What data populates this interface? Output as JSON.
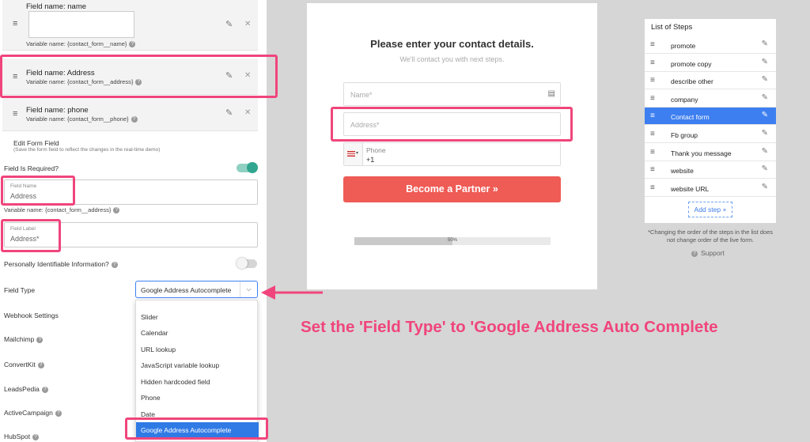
{
  "fields": {
    "name": {
      "title": "Field name: name",
      "var": "Variable name: {contact_form__name}"
    },
    "address": {
      "title": "Field name: Address",
      "var": "Variable name: {contact_form__address}"
    },
    "phone": {
      "title": "Field name: phone",
      "var": "Variable name: {contact_form__phone}"
    }
  },
  "edit": {
    "title": "Edit Form Field",
    "subtitle": "(Save the form field to reflect the changes in the real-time demo)",
    "required_label": "Field Is Required?",
    "required_on": true,
    "field_name_label": "Field Name",
    "field_name_value": "Address",
    "field_name_var": "Variable name: {contact_form__address}",
    "field_label_label": "Field Label",
    "field_label_value": "Address*",
    "pii_label": "Personally Identifiable Information?",
    "pii_on": false,
    "field_type_label": "Field Type",
    "field_type_value": "Google Address Autocomplete",
    "webhook": "Webhook Settings",
    "mailchimp": "Mailchimp",
    "convertkit": "ConvertKit",
    "leadspedia": "LeadsPedia",
    "activecampaign": "ActiveCampaign",
    "hubspot": "HubSpot"
  },
  "dropdown": {
    "options": [
      "Slider",
      "Calendar",
      "URL lookup",
      "JavaScript variable lookup",
      "Hidden hardcoded field",
      "Phone",
      "Date"
    ],
    "selected": "Google Address Autocomplete"
  },
  "form": {
    "heading": "Please enter your contact details.",
    "subheading": "We'll contact you with next steps.",
    "name_placeholder": "Name*",
    "address_placeholder": "Address*",
    "phone_label": "Phone",
    "phone_value": "+1",
    "submit": "Become a Partner »",
    "progress_text": "50%",
    "progress": 0.5
  },
  "steps": {
    "title": "List of Steps",
    "items": [
      "promote",
      "promote copy",
      "describe other",
      "company",
      "Contact form",
      "Fb group",
      "Thank you message",
      "website",
      "website URL"
    ],
    "active_index": 4,
    "add": "Add step +",
    "note": "*Changing the order of the steps in the list does not change order of the live form.",
    "support": "Support"
  },
  "annotation": "Set the 'Field Type' to 'Google Address Auto Complete",
  "colors": {
    "accent": "#f0457c",
    "brand_red": "#ef5b55",
    "toggle_on": "#31a58f",
    "select_blue": "#2f7ae5",
    "active_step": "#3d7ff0"
  }
}
